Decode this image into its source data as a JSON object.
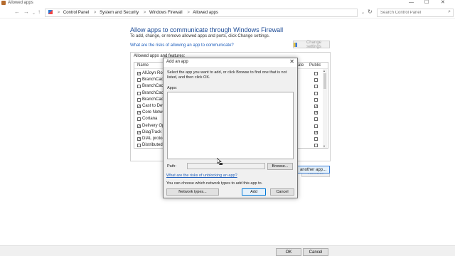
{
  "window": {
    "title": "Allowed apps",
    "minimize": "—",
    "maximize": "☐",
    "close": "✕"
  },
  "addressbar": {
    "back": "←",
    "forward": "→",
    "dropdown": "⌄",
    "up": "↑",
    "breadcrumbs": [
      "Control Panel",
      "System and Security",
      "Windows Firewall",
      "Allowed apps"
    ],
    "separator": ">",
    "refresh": "↻",
    "search_placeholder": "Search Control Panel",
    "search_icon": "⌕"
  },
  "main": {
    "heading": "Allow apps to communicate through Windows Firewall",
    "subheading": "To add, change, or remove allowed apps and ports, click Change settings.",
    "risk_link": "What are the risks of allowing an app to communicate?",
    "change_settings_label": "Change settings",
    "group_title": "Allowed apps and features:",
    "columns": {
      "name": "Name",
      "private": "ate",
      "public": "Public"
    },
    "rows": [
      {
        "name": "AllJoyn Rout",
        "checked": true,
        "public": false
      },
      {
        "name": "BranchCach",
        "checked": false,
        "public": false
      },
      {
        "name": "BranchCach",
        "checked": false,
        "public": false
      },
      {
        "name": "BranchCach",
        "checked": false,
        "public": false
      },
      {
        "name": "BranchCach",
        "checked": false,
        "public": false
      },
      {
        "name": "Cast to Devi",
        "checked": true,
        "public": true
      },
      {
        "name": "Core Netwo",
        "checked": true,
        "public": true
      },
      {
        "name": "Cortana",
        "checked": false,
        "public": false
      },
      {
        "name": "Delivery Opt",
        "checked": true,
        "public": false
      },
      {
        "name": "DiagTrack",
        "checked": true,
        "public": true
      },
      {
        "name": "DIAL protoc",
        "checked": true,
        "public": false
      },
      {
        "name": "Distributed",
        "checked": false,
        "public": false
      }
    ],
    "remove_label": "Remove",
    "allow_another_label": "another app..."
  },
  "dialog": {
    "title": "Add an app",
    "close": "✕",
    "instructions": "Select the app you want to add, or click Browse to find one that is not listed, and then click OK.",
    "apps_label": "Apps:",
    "path_label": "Path:",
    "path_value": "",
    "browse_label": "Browse...",
    "risk_link": "What are the risks of unblocking an app?",
    "types_text": "You can choose which network types to add this app to.",
    "network_types_label": "Network types...",
    "add_label": "Add",
    "cancel_label": "Cancel"
  },
  "footer": {
    "ok_label": "OK",
    "cancel_label": "Cancel"
  },
  "colors": {
    "heading": "#1b4a95",
    "link": "#1f5fbd",
    "accent_border": "#0078d7"
  }
}
